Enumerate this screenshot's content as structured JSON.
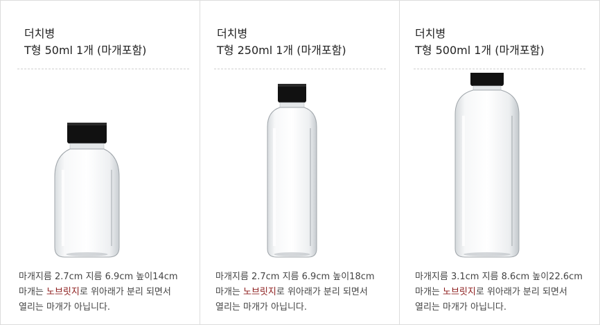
{
  "products": [
    {
      "name_line1": "더치병",
      "name_line2": "T형 50ml 1개 (마개포함)",
      "spec": "마개지름 2.7cm 지름 6.9cm  높이14cm",
      "desc_prefix": "마개는 ",
      "desc_highlight": "노브릿지",
      "desc_suffix": "로 위아래가 분리 되면서",
      "desc_line3": "열리는 마개가 아닙니다."
    },
    {
      "name_line1": "더치병",
      "name_line2": "T형 250ml 1개 (마개포함)",
      "spec": "마개지름 2.7cm 지름 6.9cm  높이18cm",
      "desc_prefix": "마개는 ",
      "desc_highlight": "노브릿지",
      "desc_suffix": "로 위아래가 분리 되면서",
      "desc_line3": "열리는 마개가 아닙니다."
    },
    {
      "name_line1": "더치병",
      "name_line2": "T형 500ml 1개 (마개포함)",
      "spec": "마개지름 3.1cm 지름 8.6cm  높이22.6cm",
      "desc_prefix": "마개는 ",
      "desc_highlight": "노브릿지",
      "desc_suffix": "로 위아래가 분리 되면서",
      "desc_line3": "열리는 마개가 아닙니다."
    }
  ],
  "colors": {
    "highlight": "#8b1a1a",
    "cap": "#111111"
  }
}
